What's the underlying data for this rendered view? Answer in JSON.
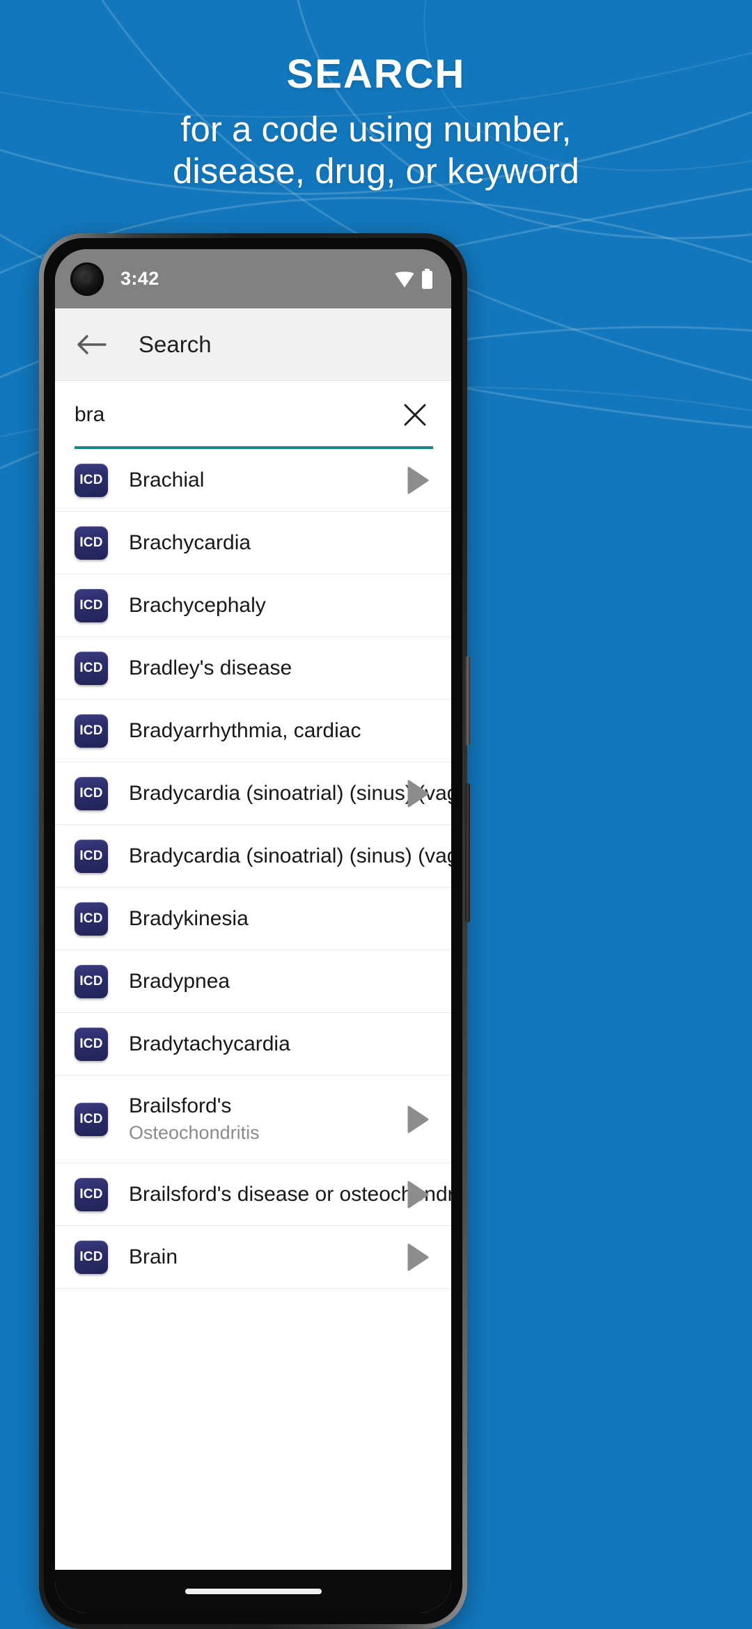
{
  "promo": {
    "background_color": "#1277bc",
    "headline": "SEARCH",
    "subtitle_line1": "for a code using number,",
    "subtitle_line2": "disease, drug, or keyword"
  },
  "phone": {
    "status_bar": {
      "time": "3:42",
      "wifi_icon": "wifi-icon",
      "battery_icon": "battery-full-icon",
      "camera_icon": "front-camera-punch-hole"
    },
    "app_bar": {
      "back_icon": "back-arrow-icon",
      "title": "Search"
    },
    "search": {
      "value": "bra",
      "placeholder": "Search",
      "clear_icon": "close-x-icon",
      "underline_color": "#158a80"
    },
    "badge_label": "ICD",
    "badge_color": "#2b2b68",
    "arrow_icon": "play-triangle-icon",
    "arrow_color": "#8d8d8d",
    "results": [
      {
        "title": "Brachial",
        "subtitle": "",
        "has_arrow": true
      },
      {
        "title": "Brachycardia",
        "subtitle": "",
        "has_arrow": false
      },
      {
        "title": "Brachycephaly",
        "subtitle": "",
        "has_arrow": false
      },
      {
        "title": "Bradley's disease",
        "subtitle": "",
        "has_arrow": false
      },
      {
        "title": "Bradyarrhythmia, cardiac",
        "subtitle": "",
        "has_arrow": false
      },
      {
        "title": "Bradycardia (sinoatrial) (sinus) (vagal)",
        "subtitle": "",
        "has_arrow": true
      },
      {
        "title": "Bradycardia (sinoatrial) (sinus) (vagal)",
        "subtitle": "",
        "has_arrow": false
      },
      {
        "title": "Bradykinesia",
        "subtitle": "",
        "has_arrow": false
      },
      {
        "title": "Bradypnea",
        "subtitle": "",
        "has_arrow": false
      },
      {
        "title": "Bradytachycardia",
        "subtitle": "",
        "has_arrow": false
      },
      {
        "title": "Brailsford's",
        "subtitle": "Osteochondritis",
        "has_arrow": true
      },
      {
        "title": "Brailsford's disease or osteochondrosis",
        "subtitle": "",
        "has_arrow": true
      },
      {
        "title": "Brain",
        "subtitle": "",
        "has_arrow": true
      }
    ],
    "gesture_bar": "home-gesture-indicator"
  }
}
